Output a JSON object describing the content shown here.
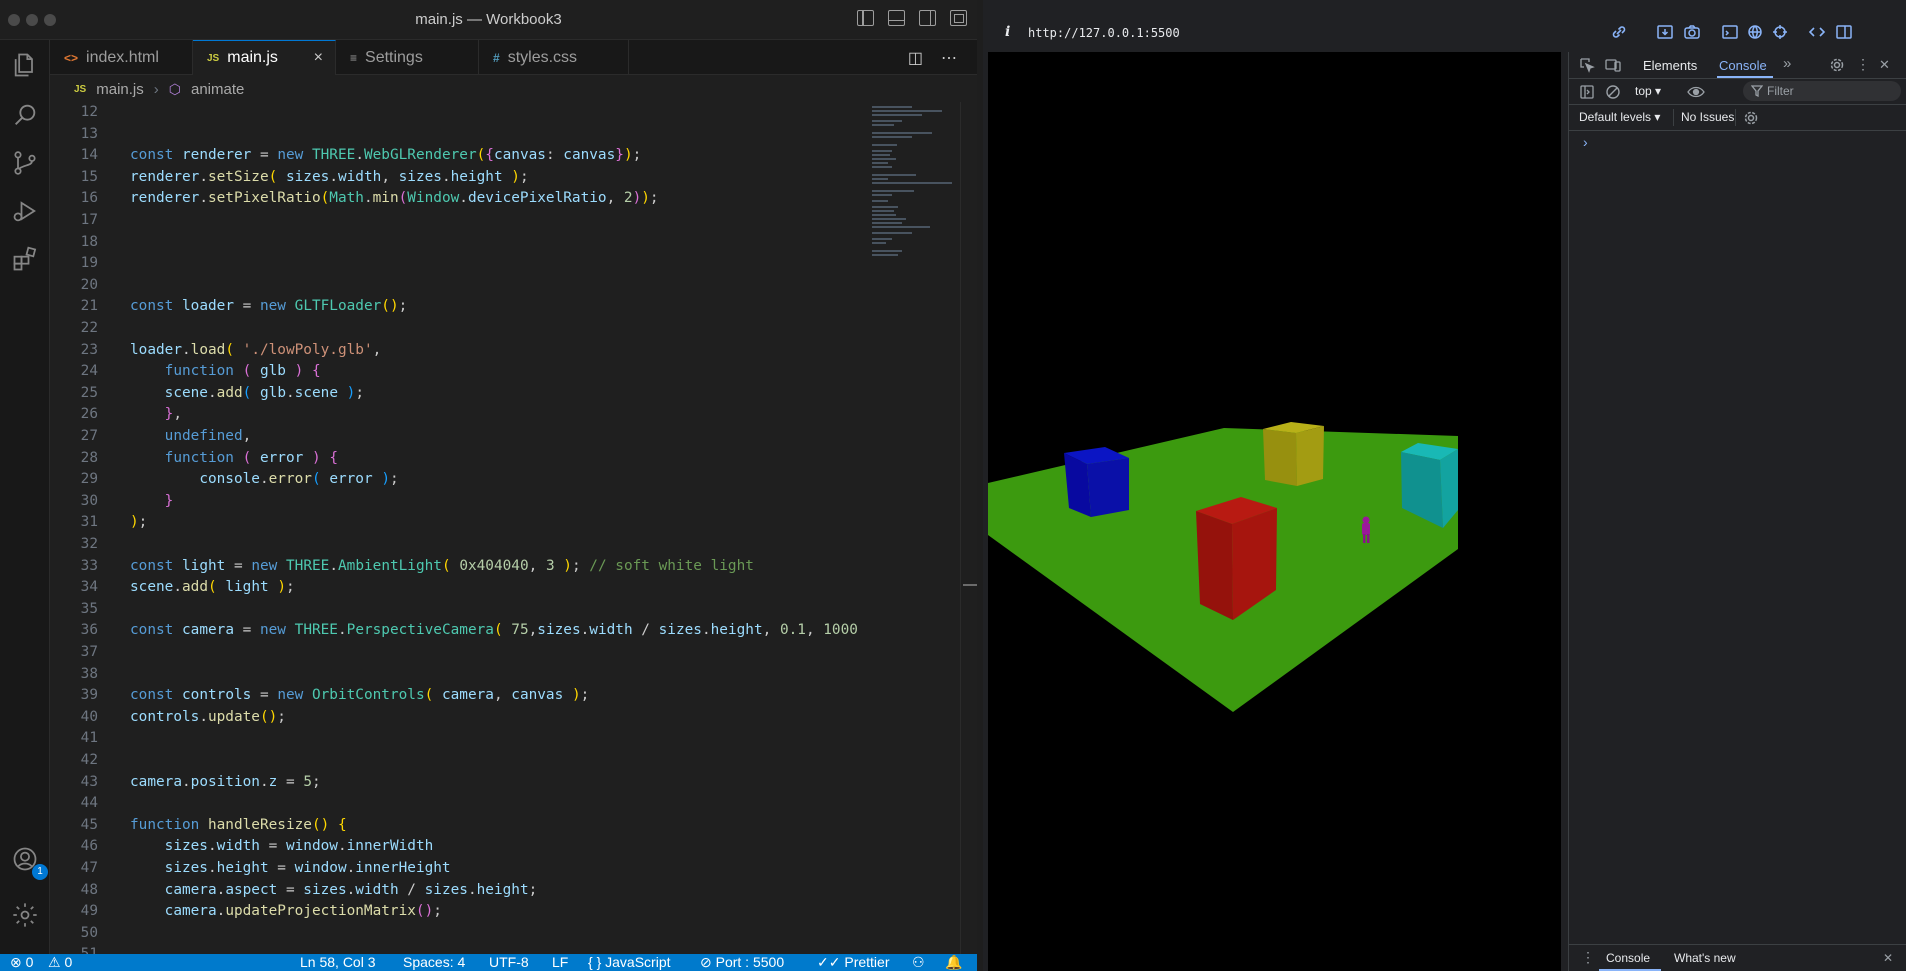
{
  "vscode": {
    "window_title": "main.js — Workbook3",
    "tabs": [
      {
        "icon": "<>",
        "label": "index.html"
      },
      {
        "icon": "JS",
        "label": "main.js",
        "close": "×"
      },
      {
        "icon": "≡",
        "label": "Settings"
      },
      {
        "icon": "#",
        "label": "styles.css"
      }
    ],
    "tab_actions": {
      "split": "◫",
      "more": "⋯"
    },
    "breadcrumb": {
      "file_icon": "JS",
      "file": "main.js",
      "symbol_icon": "⬡",
      "symbol": "animate"
    },
    "accounts_badge": "1",
    "statusbar": {
      "errors": "⊗ 0",
      "warnings": "⚠ 0",
      "cursor": "Ln 58, Col 3",
      "spaces": "Spaces: 4",
      "encoding": "UTF-8",
      "eol": "LF",
      "language": "{ }  JavaScript",
      "port": "⊘ Port : 5500",
      "prettier": "✓✓ Prettier"
    },
    "line_numbers": [
      "12",
      "13",
      "14",
      "15",
      "16",
      "17",
      "18",
      "19",
      "20",
      "21",
      "22",
      "23",
      "24",
      "25",
      "26",
      "27",
      "28",
      "29",
      "30",
      "31",
      "32",
      "33",
      "34",
      "35",
      "36",
      "37",
      "38",
      "39",
      "40",
      "41",
      "42",
      "43",
      "44",
      "45",
      "46",
      "47",
      "48",
      "49",
      "50",
      "51"
    ]
  },
  "browser": {
    "info_icon": "i",
    "url": "http://127.0.0.1:5500"
  },
  "devtools": {
    "tabs": {
      "elements": "Elements",
      "console": "Console",
      "more": "»"
    },
    "context": "top ▾",
    "filter_placeholder": "Filter",
    "levels": "Default levels ▾",
    "issues": "No Issues",
    "prompt": "›",
    "drawer": {
      "console": "Console",
      "whats_new": "What's new",
      "close": "✕",
      "menu": "⋮"
    }
  },
  "colors": {
    "statusbar": "#007acc",
    "accent": "#0078d4",
    "ground": "#3c9a0f",
    "cube_blue": "#0a10a8",
    "cube_yellow": "#a39c12",
    "cube_teal": "#13a3a0",
    "cube_red": "#a6150e",
    "figure": "#9a189a"
  }
}
